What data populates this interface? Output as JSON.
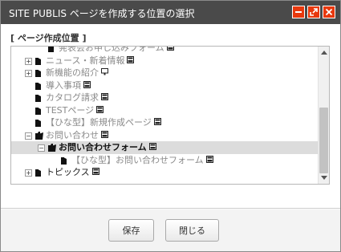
{
  "window": {
    "title": "SITE PUBLIS ページを作成する位置の選択",
    "buttons": {
      "minimize_icon": "minus-icon",
      "maximize_icon": "expand-icon",
      "close_icon": "close-icon"
    }
  },
  "section": {
    "label": "[ ページ作成位置 ]"
  },
  "tree": [
    {
      "label": "発表会お申し込みフォーム",
      "level": 1,
      "expander": "none",
      "style": "gray",
      "icon": "page"
    },
    {
      "label": "ニュース・新着情報",
      "level": 0,
      "expander": "+",
      "style": "gray",
      "icon": "page"
    },
    {
      "label": "新機能の紹介",
      "level": 0,
      "expander": "+",
      "style": "gray",
      "icon": "display"
    },
    {
      "label": "導入事項",
      "level": 0,
      "expander": "none",
      "style": "gray",
      "icon": "page"
    },
    {
      "label": "カタログ請求",
      "level": 0,
      "expander": "none",
      "style": "gray",
      "icon": "page"
    },
    {
      "label": "TESTページ",
      "level": 0,
      "expander": "none",
      "style": "gray",
      "icon": "page"
    },
    {
      "label": "【ひな型】新規作成ページ",
      "level": 0,
      "expander": "none",
      "style": "gray",
      "icon": "page"
    },
    {
      "label": "お問い合わせ",
      "level": 0,
      "expander": "-",
      "style": "gray",
      "icon": "page"
    },
    {
      "label": "お問い合わせフォーム",
      "level": 1,
      "expander": "-",
      "style": "bold",
      "icon": "page",
      "selected": true
    },
    {
      "label": "【ひな型】お問い合わせフォーム",
      "level": 2,
      "expander": "none",
      "style": "gray",
      "icon": "page"
    },
    {
      "label": "トピックス",
      "level": 0,
      "expander": "+",
      "style": "dark",
      "icon": "page"
    }
  ],
  "footer": {
    "save_label": "保存",
    "close_label": "閉じる"
  },
  "colors": {
    "titlebar": "#4a4a4a",
    "title_button": "#e8380d",
    "selected_row": "#dcdcdc"
  }
}
